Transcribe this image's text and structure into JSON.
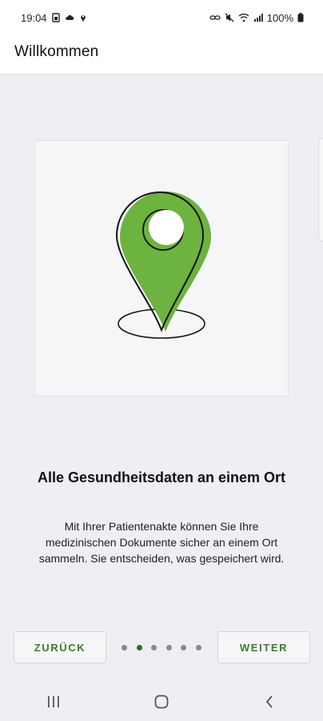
{
  "status_bar": {
    "time": "19:04",
    "battery": "100%",
    "left_icons": [
      "sim-icon",
      "cloud-icon",
      "location-icon"
    ],
    "right_icons": [
      "link-icon",
      "mute-icon",
      "wifi-icon",
      "signal-icon",
      "battery-icon"
    ]
  },
  "app_bar": {
    "title": "Willkommen"
  },
  "onboarding": {
    "illustration_icon": "location-pin-icon",
    "accent_color": "#6cb33f",
    "headline": "Alle Gesundheitsdaten an einem Ort",
    "body_lines": [
      "Mit Ihrer Patientenakte können Sie Ihre",
      "medizinischen Dokumente sicher an einem Ort",
      "sammeln. Sie entscheiden, was gespeichert wird."
    ]
  },
  "pager": {
    "back_label": "ZURÜCK",
    "next_label": "WEITER",
    "page_count": 6,
    "current_page": 2
  },
  "nav_bar": {
    "icons": [
      "recent-apps-icon",
      "home-icon",
      "back-icon"
    ]
  }
}
